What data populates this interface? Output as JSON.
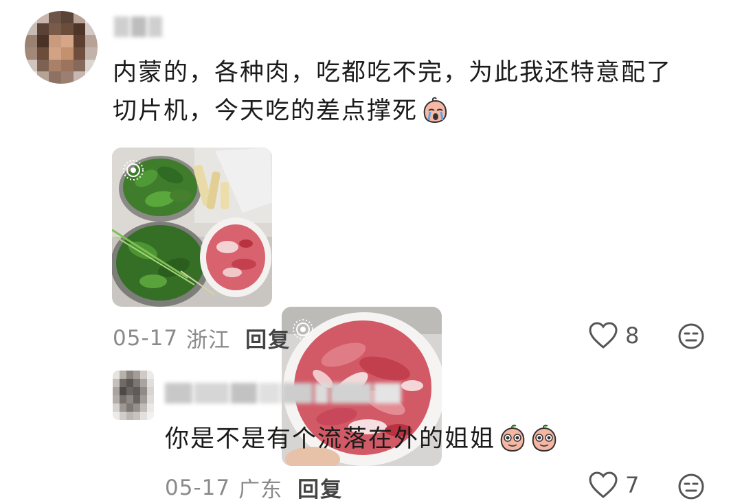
{
  "comments": [
    {
      "text_line1": "内蒙的，各种肉，吃都吃不完，为此我还特意配了",
      "text_line2": "切片机，今天吃的差点撑死",
      "sticker_icon": "crying-face-sticker-icon",
      "photos": [
        {
          "description_icon": "live-photo-badge-icon"
        },
        {
          "description_icon": "live-photo-badge-icon"
        }
      ],
      "date": "05-17",
      "location": "浙江",
      "reply_label": "回复",
      "like_count": "8"
    },
    {
      "text": "你是不是有个流落在外的姐姐",
      "sticker_icon": "shy-peach-sticker-icon",
      "date": "05-17",
      "location": "广东",
      "reply_label": "回复",
      "like_count": "7"
    }
  ],
  "icons": {
    "like": "heart-outline-icon",
    "emoji": "neutral-face-icon"
  },
  "colors": {
    "meta_text": "#8a8a8a",
    "body_text": "#1b1b1b",
    "meat": "#d8626e"
  }
}
